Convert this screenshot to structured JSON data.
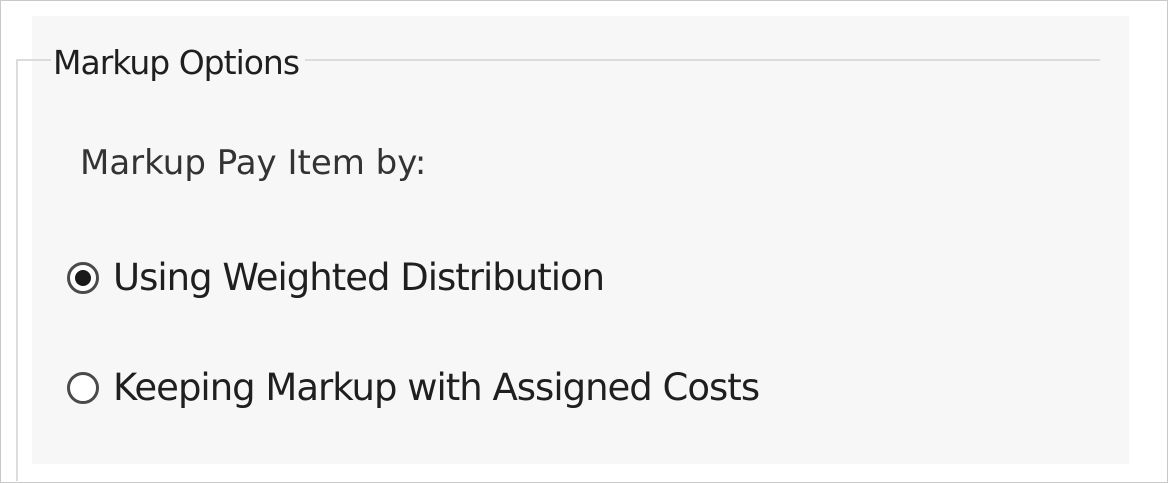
{
  "markup_options": {
    "group_title": "Markup Options",
    "prompt": "Markup Pay Item by:",
    "options": [
      {
        "label": "Using Weighted Distribution",
        "selected": true
      },
      {
        "label": "Keeping Markup with Assigned Costs",
        "selected": false
      }
    ]
  }
}
